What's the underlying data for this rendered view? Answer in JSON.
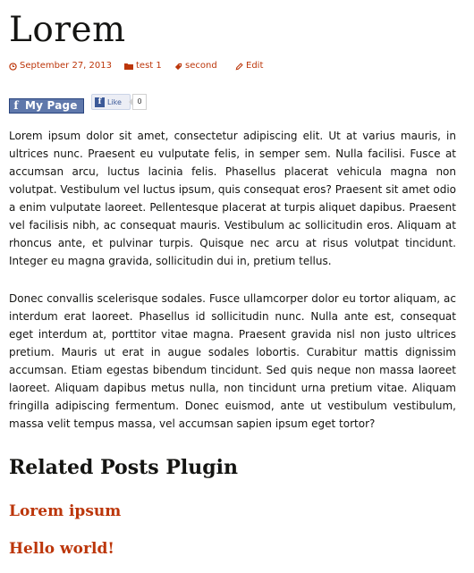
{
  "post": {
    "title": "Lorem",
    "meta": {
      "date": "September 27, 2013",
      "category": "test 1",
      "tag": "second",
      "edit": "Edit"
    },
    "share": {
      "page_button": "My Page",
      "like_label": "Like",
      "like_count": "0"
    },
    "paragraphs": [
      "Lorem ipsum dolor sit amet, consectetur adipiscing elit. Ut at varius mauris, in ultrices nunc. Praesent eu vulputate felis, in semper sem. Nulla facilisi. Fusce at accumsan arcu, luctus lacinia felis. Phasellus placerat vehicula magna non volutpat. Vestibulum vel luctus ipsum, quis consequat eros? Praesent sit amet odio a enim vulputate laoreet. Pellentesque placerat at turpis aliquet dapibus. Praesent vel facilisis nibh, ac consequat mauris. Vestibulum ac sollicitudin eros. Aliquam at rhoncus ante, et pulvinar turpis. Quisque nec arcu at risus volutpat tincidunt. Integer eu magna gravida, sollicitudin dui in, pretium tellus.",
      "Donec convallis scelerisque sodales. Fusce ullamcorper dolor eu tortor aliquam, ac interdum erat laoreet. Phasellus id sollicitudin nunc. Nulla ante est, consequat eget interdum at, porttitor vitae magna. Praesent gravida nisl non justo ultrices pretium. Mauris ut erat in augue sodales lobortis. Curabitur mattis dignissim accumsan. Etiam egestas bibendum tincidunt. Sed quis neque non massa laoreet laoreet. Aliquam dapibus metus nulla, non tincidunt urna pretium vitae. Aliquam fringilla adipiscing fermentum. Donec euismod, ante ut vestibulum vestibulum, massa velit tempus massa, vel accumsan sapien ipsum eget tortor?"
    ]
  },
  "related": {
    "heading": "Related Posts Plugin",
    "links": [
      "Lorem ipsum",
      "Hello world!"
    ]
  },
  "colors": {
    "accent": "#bc360a",
    "text": "#141412",
    "facebook": "#3b5998"
  },
  "icons": {
    "date": "clock-icon",
    "category": "folder-icon",
    "tag": "tag-icon",
    "edit": "pencil-icon"
  }
}
